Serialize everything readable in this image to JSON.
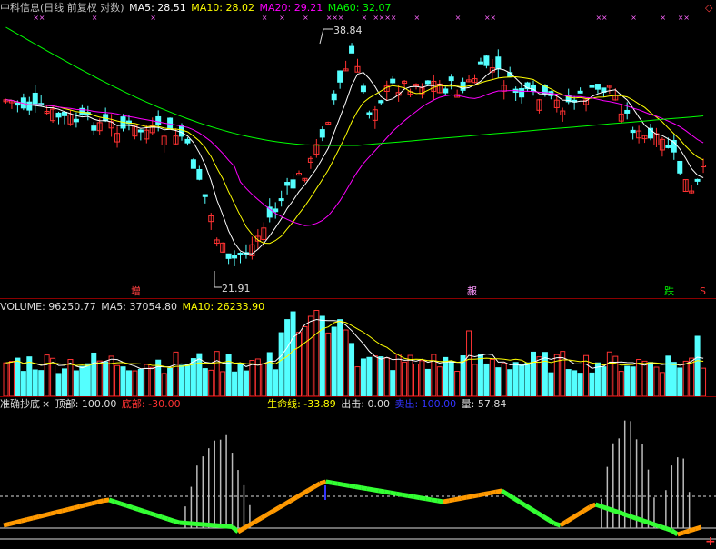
{
  "main_header": {
    "title": "中科信息(日线 前复权 对数)",
    "ma5_label": "MA5: 28.51",
    "ma10_label": "MA10: 28.02",
    "ma20_label": "MA20: 29.21",
    "ma60_label": "MA60: 32.07"
  },
  "annotations": {
    "high_label": "38.84",
    "low_label": "21.91",
    "marker_zeng": "增",
    "marker_gan": "赧",
    "marker_die": "跌",
    "marker_s": "S"
  },
  "volume_header": {
    "volume_label": "VOLUME: 96250.77",
    "ma5_label": "MA5: 37054.80",
    "ma10_label": "MA10: 26233.90"
  },
  "indicator_header": {
    "name": "准确抄底",
    "close_glyph": "×",
    "top_label": "顶部: 100.00",
    "bottom_label": "底部: -30.00",
    "life_line_label": "生命线: -33.89",
    "sell_label": "出击: 0.00",
    "sell_out_label": "卖出: 100.00",
    "amount_label": "量: 57.84"
  },
  "colors": {
    "ma5": "#ffffff",
    "ma10": "#ffff00",
    "ma20": "#ff00ff",
    "ma60": "#00ff00",
    "up": "#ff3232",
    "down": "#54ffff",
    "frame": "#8b0000",
    "title": "#c0c0c0",
    "sell_out": "#3333ff"
  },
  "chart_data": [
    {
      "type": "candlestick",
      "title": "中科信息(日线 前复权 对数)",
      "series": [
        {
          "name": "MA5",
          "last": 28.51
        },
        {
          "name": "MA10",
          "last": 28.02
        },
        {
          "name": "MA20",
          "last": 29.21
        },
        {
          "name": "MA60",
          "last": 32.07
        }
      ],
      "high_annotation": 38.84,
      "low_annotation": 21.91
    },
    {
      "type": "bar",
      "title": "VOLUME",
      "series": [
        {
          "name": "VOLUME",
          "last": 96250.77
        },
        {
          "name": "MA5",
          "last": 37054.8
        },
        {
          "name": "MA10",
          "last": 26233.9
        }
      ]
    },
    {
      "type": "line",
      "title": "准确抄底",
      "series": [
        {
          "name": "顶部",
          "last": 100.0
        },
        {
          "name": "底部",
          "last": -30.0
        },
        {
          "name": "生命线",
          "last": -33.89
        },
        {
          "name": "出击",
          "last": 0.0
        },
        {
          "name": "卖出",
          "last": 100.0
        },
        {
          "name": "量",
          "last": 57.84
        }
      ]
    }
  ]
}
